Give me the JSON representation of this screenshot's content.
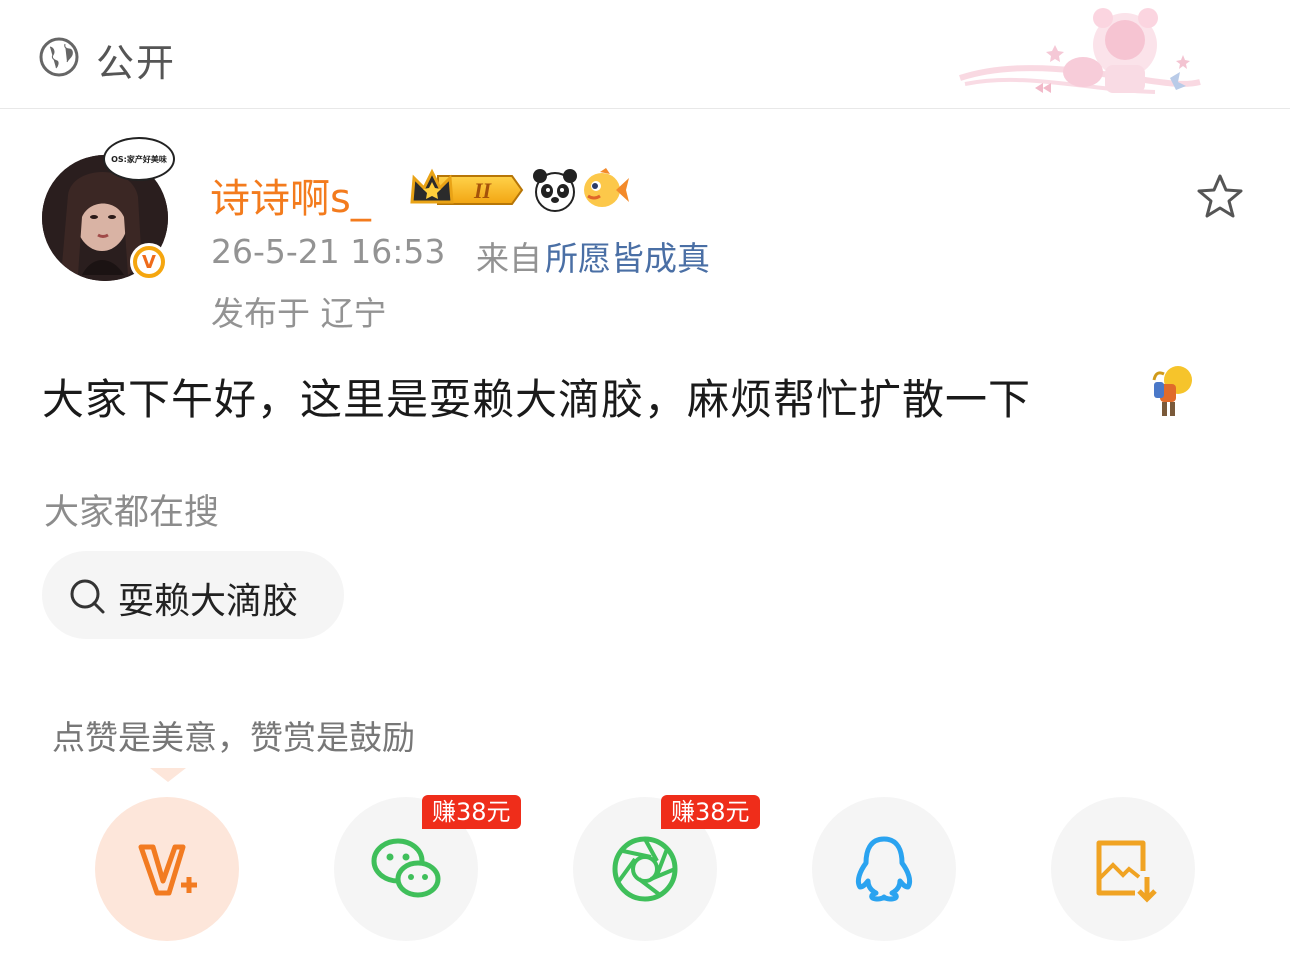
{
  "topbar": {
    "visibility": "公开"
  },
  "user": {
    "name": "诗诗啊s_",
    "avatar_bubble": "OS:家产好美味",
    "badge_letter": "V",
    "level_label": "II"
  },
  "meta": {
    "time": "26-5-21 16:53",
    "from_label": "来自",
    "source": "所愿皆成真",
    "location": "发布于 辽宁"
  },
  "post": {
    "text": "大家下午好，这里是耍赖大滴胶，麻烦帮忙扩散一下"
  },
  "trending": {
    "label": "大家都在搜",
    "query": "耍赖大滴胶"
  },
  "reward_tip": "点赞是美意，赞赏是鼓励",
  "share": {
    "wechat_earn": "赚38元",
    "moments_earn": "赚38元"
  },
  "colors": {
    "username": "#f37b1d",
    "source_link": "#4a6fa5",
    "earn_badge": "#ef2d1a",
    "wechat": "#3fbf5a",
    "qq": "#2aa3f0",
    "save": "#f0a323"
  }
}
